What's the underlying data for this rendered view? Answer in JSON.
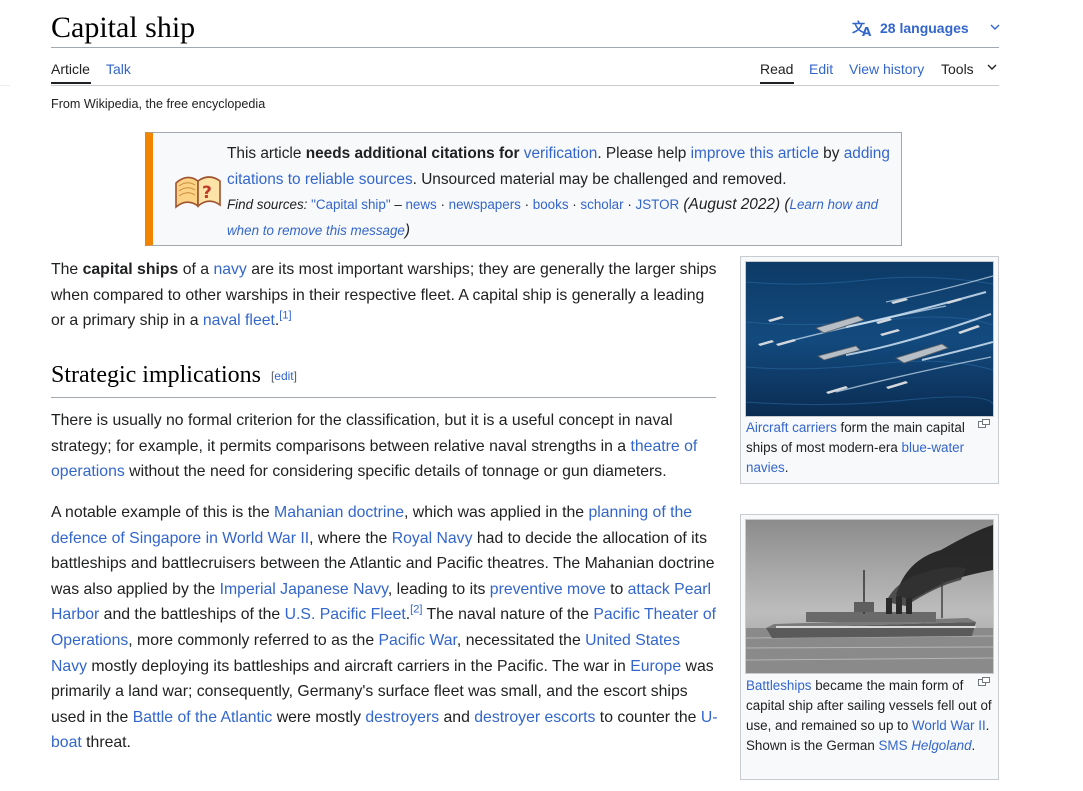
{
  "header": {
    "title": "Capital ship",
    "languages_label": "28 languages",
    "languages_icon": "translate-icon",
    "chevron_icon": "chevron-down-icon"
  },
  "tabs": {
    "left": [
      {
        "label": "Article",
        "active": true
      },
      {
        "label": "Talk",
        "active": false
      }
    ],
    "right": [
      {
        "label": "Read",
        "active": true
      },
      {
        "label": "Edit",
        "active": false
      },
      {
        "label": "View history",
        "active": false
      },
      {
        "label": "Tools",
        "active": false
      }
    ]
  },
  "tagline": "From Wikipedia, the free encyclopedia",
  "ambox": {
    "icon": "book-question-icon",
    "accent_color": "#f28500",
    "line1_a": "This article ",
    "line1_bold": "needs additional citations for ",
    "line1_link": "verification",
    "line1_b": ". Please help ",
    "line1_link2": "improve this article",
    "line1_c": " by ",
    "line1_link3": "adding citations to reliable sources",
    "line1_d": ". Unsourced material may be challenged and removed.",
    "find_sources": "Find sources: ",
    "fs_query": "\"Capital ship\"",
    "fs_dash": " – ",
    "fs_news": "news",
    "fs_newspapers": "newspapers",
    "fs_books": "books",
    "fs_scholar": "scholar",
    "fs_jstor": "JSTOR",
    "sep": " · ",
    "date": " (August 2022)",
    "paren_open": " (",
    "learn": "Learn how and when to remove this message",
    "paren_close": ")"
  },
  "intro": {
    "t1": "The ",
    "b1": "capital ships",
    "t2": " of a ",
    "l1": "navy",
    "t3": " are its most important warships; they are generally the larger ships when compared to other warships in their respective fleet. A capital ship is generally a leading or a primary ship in a ",
    "l2": "naval fleet",
    "t4": ".",
    "ref1": "[1]"
  },
  "section": {
    "heading": "Strategic implications",
    "edit_bracket_open": "[",
    "edit": "edit",
    "edit_bracket_close": "]"
  },
  "para1": {
    "t1": "There is usually no formal criterion for the classification, but it is a useful concept in naval strategy; for example, it permits comparisons between relative naval strengths in a ",
    "l1": "theatre of operations",
    "t2": " without the need for considering specific details of tonnage or gun diameters."
  },
  "para2": {
    "t1": "A notable example of this is the ",
    "l1": "Mahanian doctrine",
    "t2": ", which was applied in the ",
    "l2": "planning of the defence of Singapore in World War II",
    "t3": ", where the ",
    "l3": "Royal Navy",
    "t4": " had to decide the allocation of its battleships and battlecruisers between the Atlantic and Pacific theatres. The Mahanian doctrine was also applied by the ",
    "l4": "Imperial Japanese Navy",
    "t5": ", leading to its ",
    "l5": "preventive move",
    "t6": " to ",
    "l6": "attack Pearl Harbor",
    "t7": " and the battleships of the ",
    "l7": "U.S. Pacific Fleet",
    "t8": ".",
    "ref2": "[2]",
    "t9": " The naval nature of the ",
    "l8": "Pacific Theater of Operations",
    "t10": ", more commonly referred to as the ",
    "l9": "Pacific War",
    "t11": ", necessitated the ",
    "l10": "United States Navy",
    "t12": " mostly deploying its battleships and aircraft carriers in the Pacific. The war in ",
    "l11": "Europe",
    "t13": " was primarily a land war; consequently, Germany's surface fleet was small, and the escort ships used in the ",
    "l12": "Battle of the Atlantic",
    "t14": " were mostly ",
    "l13": "destroyers",
    "t15": " and ",
    "l14": "destroyer escorts",
    "t16": " to counter the ",
    "l15": "U-boat",
    "t17": " threat."
  },
  "thumb1": {
    "image": "aircraft-carrier-fleet-image",
    "l1": "Aircraft carriers",
    "t1": " form the main capital ships of most modern-era ",
    "l2": "blue-water navies",
    "t2": "."
  },
  "thumb2": {
    "image": "battleship-helgoland-image",
    "l1": "Battleships",
    "t1": " became the main form of capital ship after sailing vessels fell out of use, and remained so up to ",
    "l2": "World War II",
    "t2": ". Shown is the German ",
    "l3": "SMS ",
    "l3i": "Helgoland",
    "t3": "."
  }
}
